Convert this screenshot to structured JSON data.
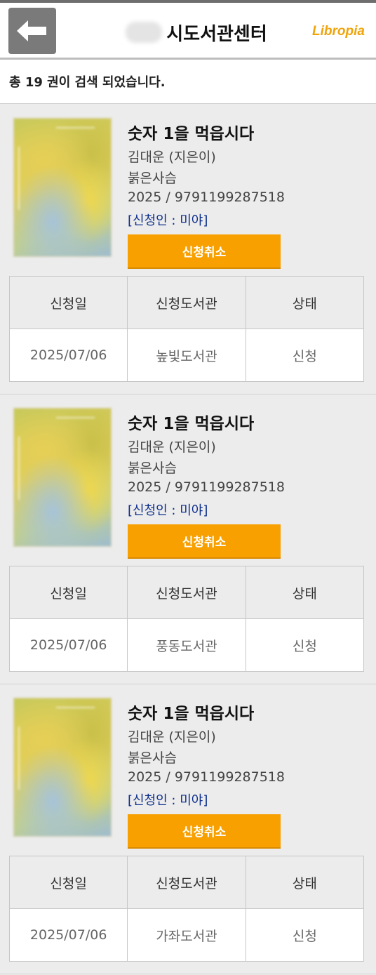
{
  "header": {
    "title": "시도서관센터",
    "logo": "Libropia",
    "back_icon": "arrow-left-icon"
  },
  "result_summary": "총 19 권이 검색 되었습니다.",
  "table_headers": [
    "신청일",
    "신청도서관",
    "상태"
  ],
  "items": [
    {
      "title": "숫자 1을 먹읍시다",
      "author": "김대운 (지은이)",
      "publisher": "붉은사슴",
      "year_isbn": "2025 / 9791199287518",
      "applicant": "[신청인 :    미야]",
      "cancel_label": "신청취소",
      "row": [
        "2025/07/06",
        "높빛도서관",
        "신청"
      ]
    },
    {
      "title": "숫자 1을 먹읍시다",
      "author": "김대운 (지은이)",
      "publisher": "붉은사슴",
      "year_isbn": "2025 / 9791199287518",
      "applicant": "[신청인 :    미야]",
      "cancel_label": "신청취소",
      "row": [
        "2025/07/06",
        "풍동도서관",
        "신청"
      ]
    },
    {
      "title": "숫자 1을 먹읍시다",
      "author": "김대운 (지은이)",
      "publisher": "붉은사슴",
      "year_isbn": "2025 / 9791199287518",
      "applicant": "[신청인 :    미야]",
      "cancel_label": "신청취소",
      "row": [
        "2025/07/06",
        "가좌도서관",
        "신청"
      ]
    }
  ],
  "colors": {
    "accent": "#f8a000",
    "applicant_text": "#0b2d8a",
    "logo": "#f0a30a"
  }
}
